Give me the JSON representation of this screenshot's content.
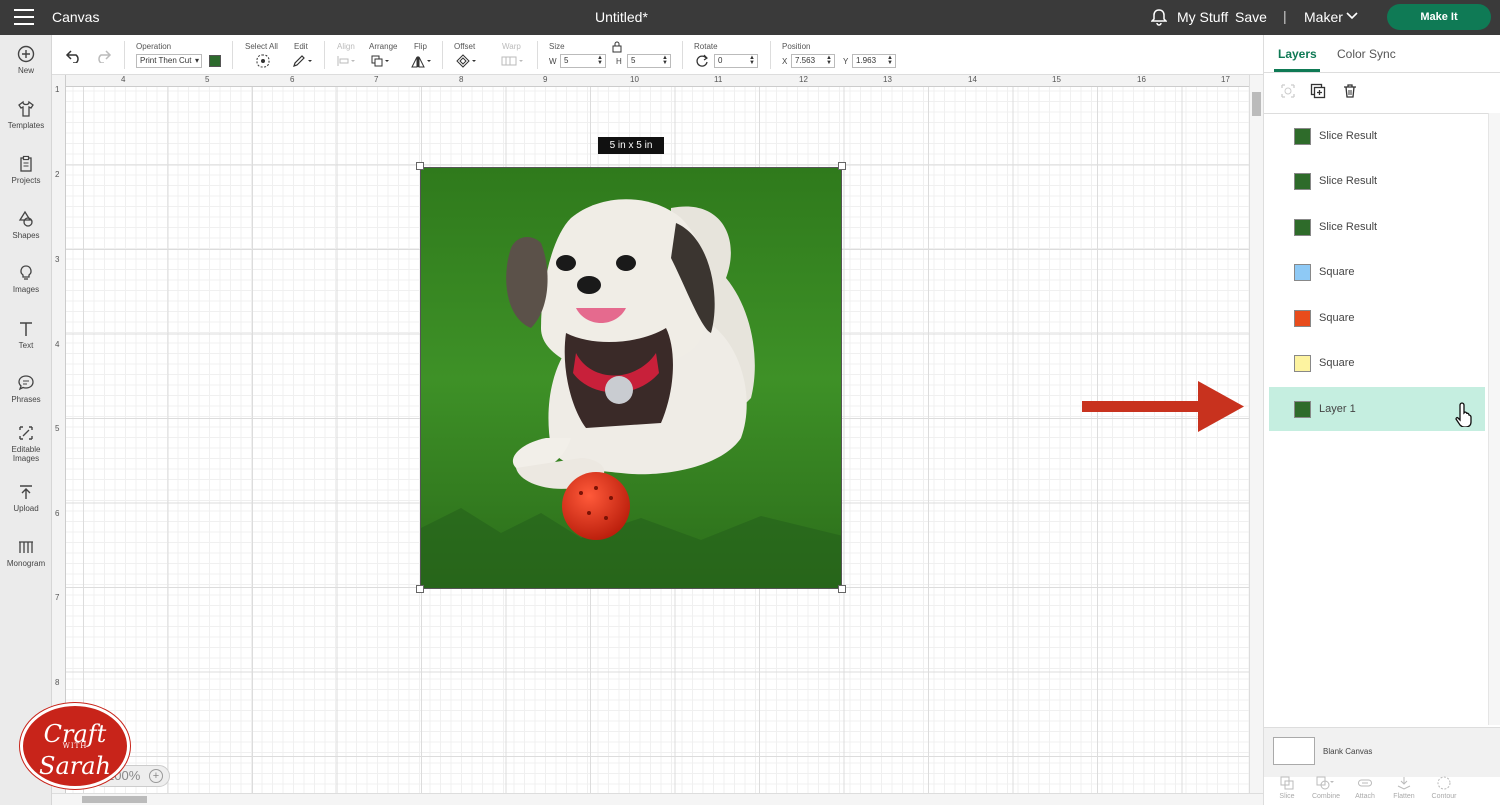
{
  "topbar": {
    "app_title": "Canvas",
    "doc_title": "Untitled*",
    "my_stuff": "My Stuff",
    "save": "Save",
    "separator": "|",
    "machine": "Maker",
    "make_it": "Make It",
    "accent": "#0f7a55"
  },
  "leftbar": {
    "items": [
      {
        "label": "New",
        "icon": "plus-circle-icon"
      },
      {
        "label": "Templates",
        "icon": "shirt-icon"
      },
      {
        "label": "Projects",
        "icon": "clipboard-icon"
      },
      {
        "label": "Shapes",
        "icon": "shapes-icon"
      },
      {
        "label": "Images",
        "icon": "lightbulb-icon"
      },
      {
        "label": "Text",
        "icon": "text-icon"
      },
      {
        "label": "Phrases",
        "icon": "speech-bubble-icon"
      },
      {
        "label": "Editable Images",
        "icon": "editable-image-icon"
      },
      {
        "label": "Upload",
        "icon": "upload-icon"
      },
      {
        "label": "Monogram",
        "icon": "monogram-icon"
      }
    ]
  },
  "toolbar": {
    "operation_label": "Operation",
    "operation_value": "Print Then Cut",
    "select_all_label": "Select All",
    "edit_label": "Edit",
    "align_label": "Align",
    "arrange_label": "Arrange",
    "flip_label": "Flip",
    "offset_label": "Offset",
    "warp_label": "Warp",
    "size_label": "Size",
    "w_label": "W",
    "w_value": "5",
    "h_label": "H",
    "h_value": "5",
    "rotate_label": "Rotate",
    "rotate_value": "0",
    "position_label": "Position",
    "x_label": "X",
    "x_value": "7.563",
    "y_label": "Y",
    "y_value": "1.963"
  },
  "rulers": {
    "top": [
      "4",
      "5",
      "6",
      "7",
      "8",
      "9",
      "10",
      "11",
      "12",
      "13",
      "14",
      "15",
      "16",
      "17"
    ],
    "left": [
      "1",
      "2",
      "3",
      "4",
      "5",
      "6",
      "7",
      "8"
    ]
  },
  "canvas": {
    "size_badge": "5  in x 5  in",
    "zoom": "100%"
  },
  "logo": {
    "line1": "Craft",
    "line2": "WITH",
    "line3": "Sarah"
  },
  "panel": {
    "tabs": [
      "Layers",
      "Color Sync"
    ],
    "layers": [
      {
        "name": "Slice Result",
        "swatch": "image"
      },
      {
        "name": "Slice Result",
        "swatch": "image"
      },
      {
        "name": "Slice Result",
        "swatch": "image"
      },
      {
        "name": "Square",
        "swatch": "#8ec9f5"
      },
      {
        "name": "Square",
        "swatch": "#e84c1c"
      },
      {
        "name": "Square",
        "swatch": "#fdf3a0"
      },
      {
        "name": "Layer 1",
        "swatch": "image",
        "selected": true
      }
    ],
    "blank_canvas": "Blank Canvas",
    "bottom_actions": [
      "Slice",
      "Combine",
      "Attach",
      "Flatten",
      "Contour"
    ],
    "selected_color": "#c5eee0",
    "arrow_color": "#c8321e"
  }
}
